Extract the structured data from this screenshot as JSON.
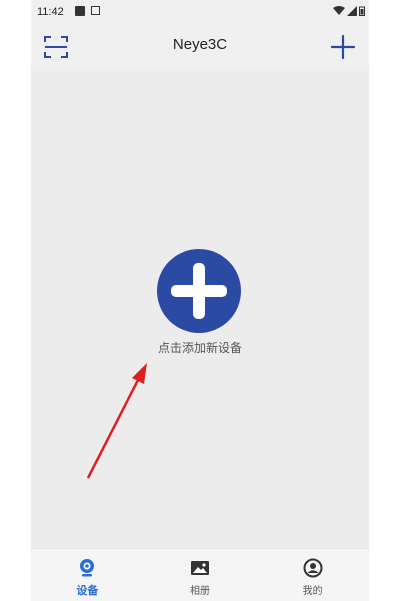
{
  "status_bar": {
    "time": "11:42"
  },
  "header": {
    "title": "Neye3C"
  },
  "main": {
    "add_hint": "点击添加新设备"
  },
  "tabs": [
    {
      "label": "设备",
      "icon": "camera-icon",
      "active": true
    },
    {
      "label": "相册",
      "icon": "image-icon",
      "active": false
    },
    {
      "label": "我的",
      "icon": "profile-icon",
      "active": false
    }
  ],
  "colors": {
    "accent": "#2b4aa3",
    "tab_active": "#2b6fd6",
    "annotation_arrow": "#e02020"
  }
}
